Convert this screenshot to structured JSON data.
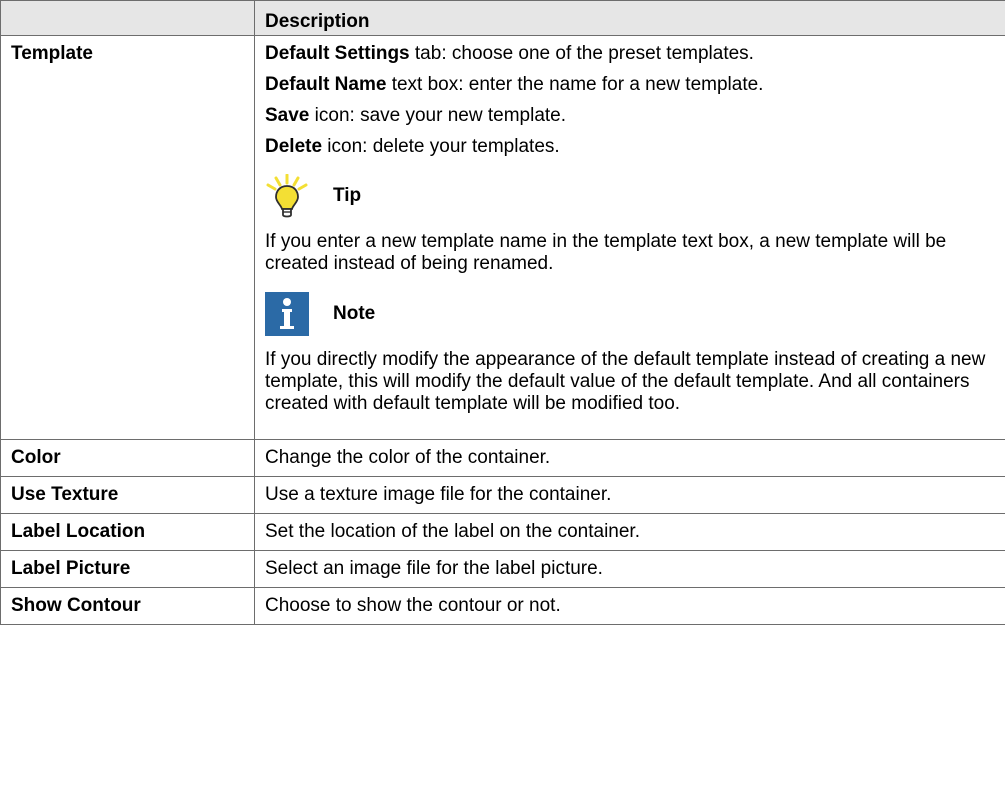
{
  "header": {
    "col1": "",
    "col2": "Description"
  },
  "template_row": {
    "name": "Template",
    "lines": [
      {
        "bold": "Default Settings",
        "rest": " tab: choose one of the preset templates."
      },
      {
        "bold": "Default Name",
        "rest": " text box: enter the name for a new template."
      },
      {
        "bold": "Save",
        "rest": " icon: save your new template."
      },
      {
        "bold": "Delete",
        "rest": " icon: delete your templates."
      }
    ],
    "tip": {
      "title": "Tip",
      "icon": "lightbulb-icon",
      "text": "If you enter a new template name in the template text box, a new template will be created instead of being renamed."
    },
    "note": {
      "title": "Note",
      "icon": "info-icon",
      "text": "If you directly modify the appearance of the default template instead of creating a new template, this will modify the default value of the default template. And all containers created with default template will be modified too."
    }
  },
  "rows": [
    {
      "name": "Color",
      "desc": "Change the color of the container."
    },
    {
      "name": "Use Texture",
      "desc": "Use a texture image file for the container."
    },
    {
      "name": "Label Location",
      "desc": "Set the location of the label on the container."
    },
    {
      "name": "Label Picture",
      "desc": "Select an image file for the label picture."
    },
    {
      "name": "Show Contour",
      "desc": "Choose to show the contour or not."
    }
  ],
  "colors": {
    "header_bg": "#e6e6e6",
    "note_blue": "#2b6aa6",
    "tip_yellow": "#f3df34"
  }
}
